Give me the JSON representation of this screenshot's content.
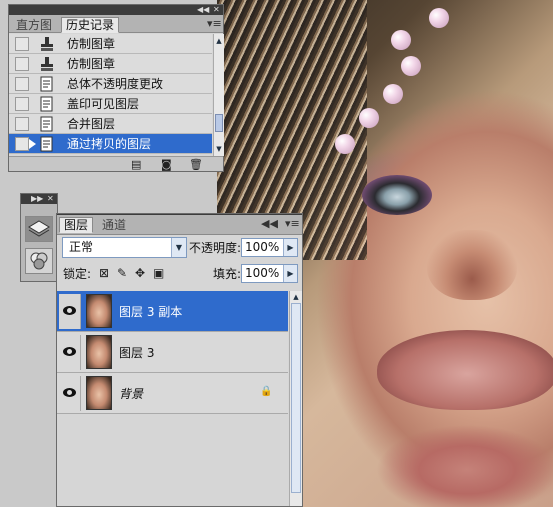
{
  "history_panel": {
    "tabs": [
      "直方图",
      "历史记录"
    ],
    "active_tab": "历史记录",
    "menu_icon": "panel-menu-icon",
    "rows": [
      {
        "label": "仿制图章",
        "icon": "clone-stamp-icon"
      },
      {
        "label": "仿制图章",
        "icon": "clone-stamp-icon"
      },
      {
        "label": "总体不透明度更改",
        "icon": "history-state-icon"
      },
      {
        "label": "盖印可见图层",
        "icon": "history-state-icon"
      },
      {
        "label": "合并图层",
        "icon": "history-state-icon"
      },
      {
        "label": "通过拷贝的图层",
        "icon": "history-state-icon",
        "selected": true
      }
    ],
    "footer_icons": [
      "new-document-from-state-icon",
      "snapshot-camera-icon",
      "trash-icon"
    ]
  },
  "layers_panel": {
    "tabs": [
      "图层",
      "通道"
    ],
    "active_tab": "图层",
    "blend_mode": "正常",
    "opacity_label": "不透明度:",
    "opacity_value": "100%",
    "lock_label": "锁定:",
    "lock_icons": [
      "lock-transparent-icon",
      "lock-paint-brush-icon",
      "lock-move-icon",
      "lock-all-icon"
    ],
    "fill_label": "填充:",
    "fill_value": "100%",
    "layers": [
      {
        "name": "图层 3 副本",
        "visible": true,
        "selected": true,
        "locked": false
      },
      {
        "name": "图层 3",
        "visible": true,
        "selected": false,
        "locked": false
      },
      {
        "name": "背景",
        "visible": true,
        "selected": false,
        "locked": true,
        "italic": true
      }
    ]
  },
  "icon_strip": {
    "buttons": [
      "layers-stack-icon",
      "channels-icon"
    ],
    "active": "layers-stack-icon"
  }
}
